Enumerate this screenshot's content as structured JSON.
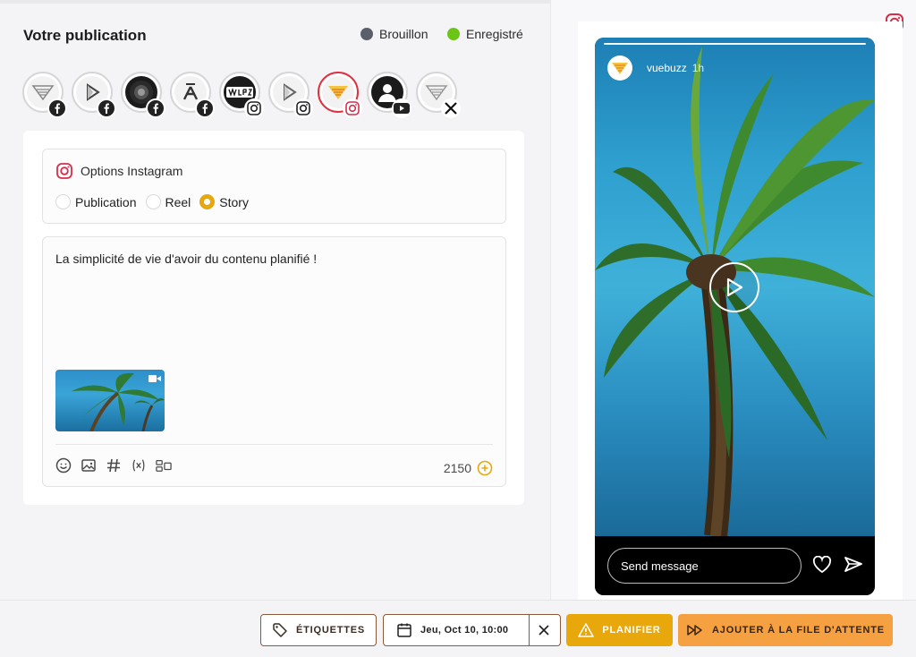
{
  "header": {
    "title": "Votre publication",
    "status_draft": {
      "label": "Brouillon",
      "color": "#5b5f6b"
    },
    "status_saved": {
      "label": "Enregistré",
      "color": "#6cc417"
    }
  },
  "accounts": [
    {
      "network": "facebook",
      "selected": false
    },
    {
      "network": "facebook",
      "selected": false
    },
    {
      "network": "facebook",
      "selected": false
    },
    {
      "network": "facebook",
      "selected": false
    },
    {
      "network": "instagram",
      "selected": false
    },
    {
      "network": "instagram",
      "selected": false
    },
    {
      "network": "instagram",
      "selected": true
    },
    {
      "network": "youtube",
      "selected": false
    },
    {
      "network": "x",
      "selected": false
    }
  ],
  "instagram_options": {
    "title": "Options Instagram",
    "types": [
      {
        "label": "Publication",
        "selected": false
      },
      {
        "label": "Reel",
        "selected": false
      },
      {
        "label": "Story",
        "selected": true
      }
    ]
  },
  "editor": {
    "text": "La simplicité de vie d'avoir du contenu planifié !",
    "char_count": "2150",
    "tools": [
      "emoji-icon",
      "image-icon",
      "hashtag-icon",
      "variable-icon",
      "layout-icon"
    ]
  },
  "preview": {
    "username": "vuebuzz",
    "time": "1h",
    "send_placeholder": "Send message"
  },
  "footer": {
    "tags_label": "ÉTIQUETTES",
    "date_label": "Jeu, Oct 10, 10:00",
    "schedule_label": "PLANIFIER",
    "queue_label": "AJOUTER À LA FILE D'ATTENTE"
  },
  "colors": {
    "accent": "#e8a80b",
    "queue": "#f5a142",
    "instagram": "#d62f4b"
  }
}
